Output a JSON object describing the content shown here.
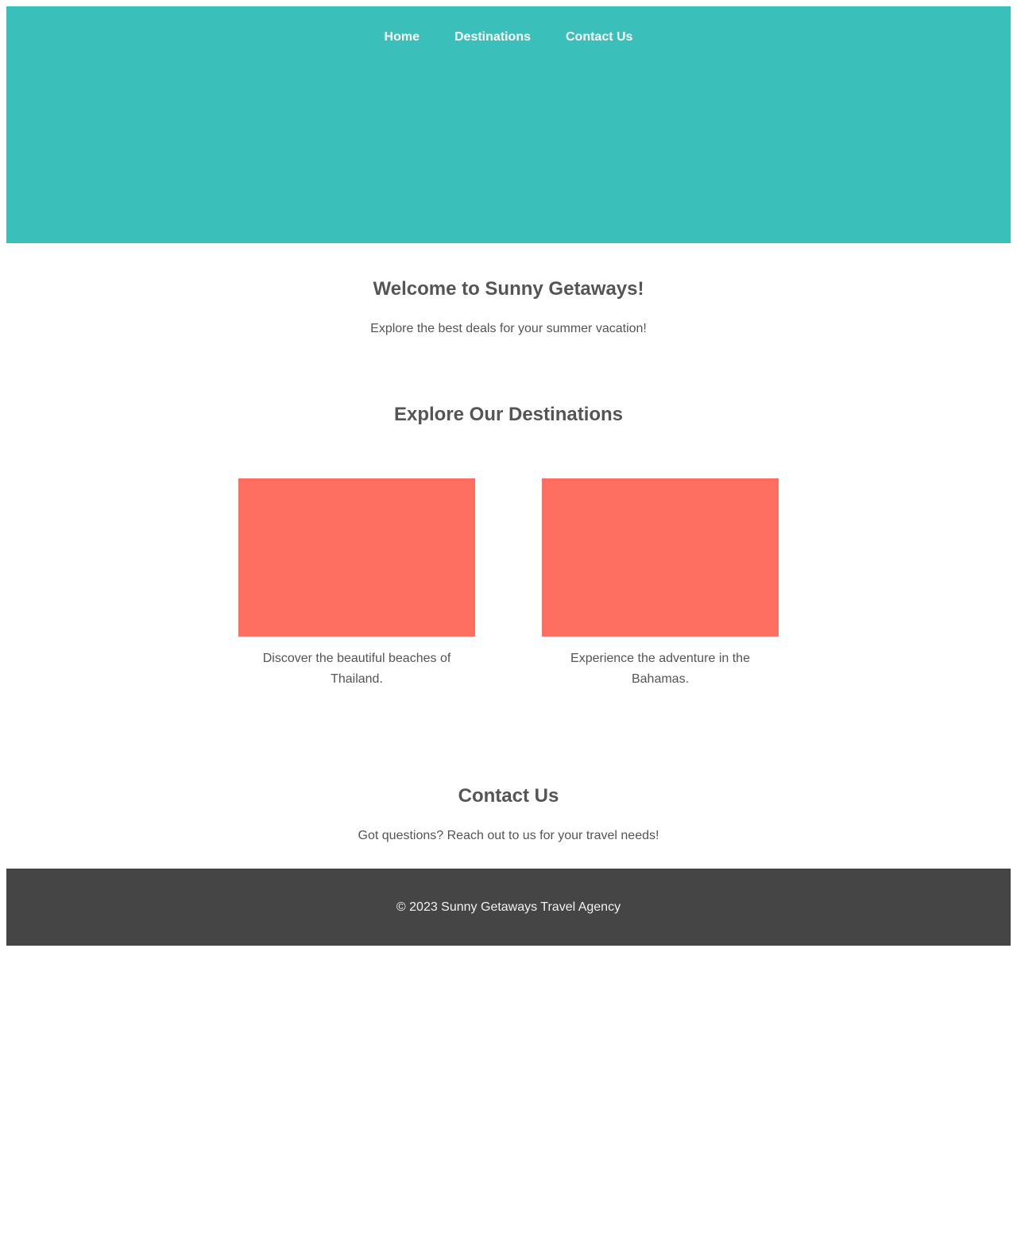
{
  "nav": {
    "items": [
      {
        "label": "Home"
      },
      {
        "label": "Destinations"
      },
      {
        "label": "Contact Us"
      }
    ]
  },
  "welcome": {
    "title": "Welcome to Sunny Getaways!",
    "subtitle": "Explore the best deals for your summer vacation!"
  },
  "destinations": {
    "title": "Explore Our Destinations",
    "cards": [
      {
        "text": "Discover the beautiful beaches of Thailand."
      },
      {
        "text": "Experience the adventure in the Bahamas."
      }
    ]
  },
  "contact": {
    "title": "Contact Us",
    "text": "Got questions? Reach out to us for your travel needs!"
  },
  "footer": {
    "text": "© 2023 Sunny Getaways Travel Agency"
  },
  "colors": {
    "hero": "#3bbfba",
    "card_image": "#ff6f61",
    "footer": "#454545",
    "text": "#555555"
  }
}
